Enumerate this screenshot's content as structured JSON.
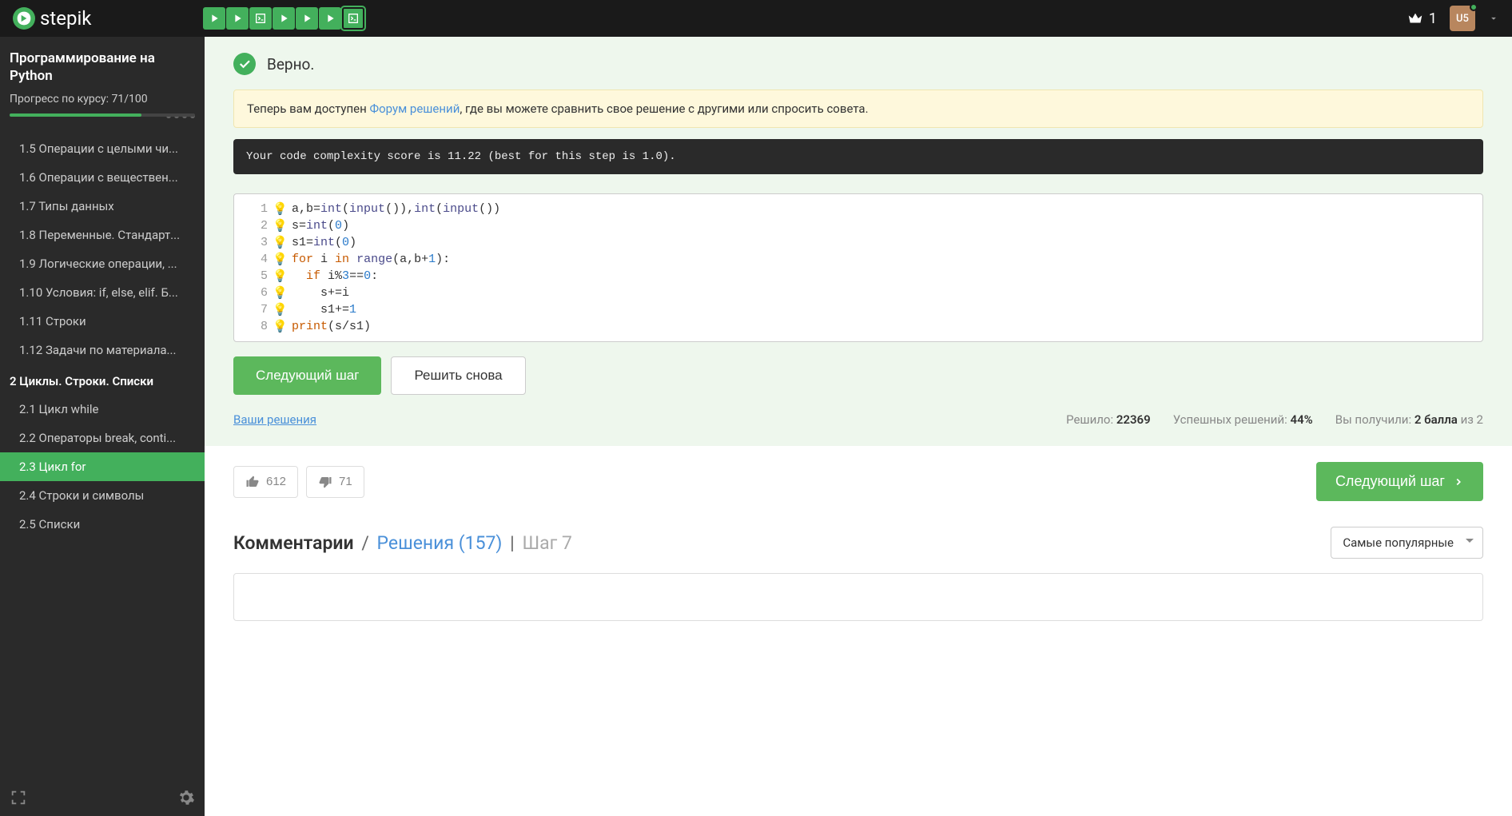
{
  "brand": "stepik",
  "topbar": {
    "crown_count": "1",
    "avatar_text": "U5"
  },
  "sidebar": {
    "course_title": "Программирование на Python",
    "progress_label": "Прогресс по курсу:",
    "progress_value": "71/100",
    "items1": [
      "1.5  Операции с целыми чи...",
      "1.6  Операции с веществен...",
      "1.7  Типы данных",
      "1.8  Переменные. Стандарт...",
      "1.9  Логические операции, ...",
      "1.10  Условия: if, else, elif. Б...",
      "1.11  Строки",
      "1.12  Задачи по материала..."
    ],
    "section2": "2  Циклы. Строки. Списки",
    "items2": [
      "2.1  Цикл while",
      "2.2  Операторы break, conti...",
      "2.3  Цикл for",
      "2.4  Строки и символы",
      "2.5  Списки"
    ],
    "active_index": 2
  },
  "result": {
    "correct": "Верно.",
    "banner_pre": "Теперь вам доступен ",
    "banner_link": "Форум решений",
    "banner_post": ", где вы можете сравнить свое решение с другими или спросить совета.",
    "complexity": "Your code complexity score is 11.22 (best for this step is 1.0)."
  },
  "code": {
    "lines": [
      "a,b=int(input()),int(input())",
      "s=int(0)",
      "s1=int(0)",
      "for i in range(a,b+1):",
      "  if i%3==0:",
      "    s+=i",
      "    s1+=1",
      "print(s/s1)"
    ]
  },
  "actions": {
    "next": "Следующий шаг",
    "retry": "Решить снова",
    "your_solutions": "Ваши решения"
  },
  "stats": {
    "solved_label": "Решило:",
    "solved_val": "22369",
    "success_label": "Успешных решений:",
    "success_val": "44%",
    "points_label": "Вы получили:",
    "points_val": "2 балла",
    "points_of": "из 2"
  },
  "votes": {
    "up": "612",
    "down": "71",
    "next_step": "Следующий шаг"
  },
  "comments": {
    "tab1": "Комментарии",
    "tab2": "Решения (157)",
    "step": "Шаг 7",
    "sort": "Самые популярные"
  }
}
